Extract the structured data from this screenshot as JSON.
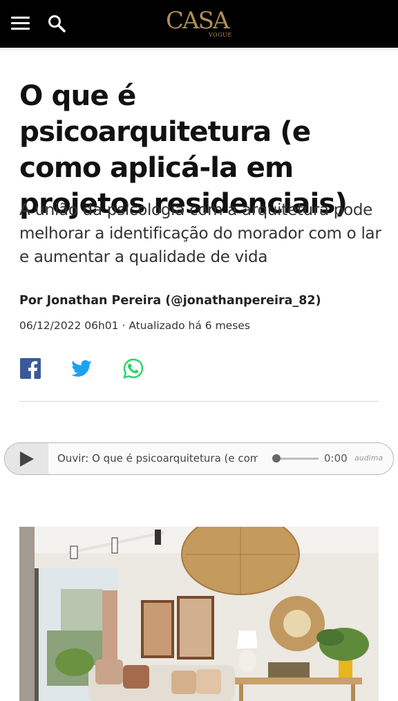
{
  "header": {
    "logo_main": "CASA",
    "logo_sub": "VOGUE",
    "brand_color": "#b0904f",
    "menu_icon": "menu-icon",
    "search_icon": "search-icon"
  },
  "article": {
    "title": "O que é psicoarquitetura (e como aplicá-la em projetos residenciais)",
    "subtitle": "A união da psicologia com a arquitetura pode melhorar a identificação do morador com o lar e aumentar a qualidade de vida",
    "byline": "Por Jonathan Pereira (@jonathanpereira_82)",
    "dateline": "06/12/2022 06h01 · Atualizado há 6 meses"
  },
  "share": {
    "facebook_icon": "facebook-icon",
    "twitter_icon": "twitter-icon",
    "whatsapp_icon": "whatsapp-icon",
    "facebook_color": "#3b5998",
    "twitter_color": "#1da1f2",
    "whatsapp_color": "#25d366"
  },
  "player": {
    "title": "Ouvir: O que é psicoarquitetura (e como aplicá-la em projetos residenciais)",
    "time": "0:00",
    "brand": "audima",
    "progress": 0
  }
}
